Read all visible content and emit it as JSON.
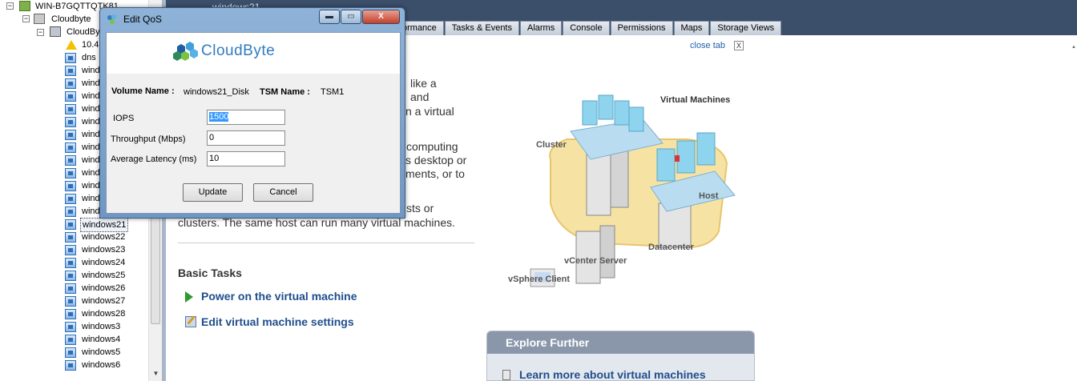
{
  "tree": {
    "root_label": "WIN-B7GQTTQTK81",
    "datacenter_label": "Cloudbyte",
    "cluster_label": "CloudBy",
    "host_label": "10.4",
    "items": [
      "dns",
      "windo",
      "windo",
      "windo",
      "windo",
      "windo",
      "windo",
      "windo",
      "windo",
      "windo",
      "windo",
      "windo",
      "windows20",
      "windows21",
      "windows22",
      "windows23",
      "windows24",
      "windows25",
      "windows26",
      "windows27",
      "windows28",
      "windows3",
      "windows4",
      "windows5",
      "windows6"
    ],
    "selected_item": "windows21",
    "expander_open": "−"
  },
  "header": {
    "vm_title": "windows21"
  },
  "tabs": [
    {
      "label": "ormance"
    },
    {
      "label": "Tasks & Events"
    },
    {
      "label": "Alarms"
    },
    {
      "label": "Console"
    },
    {
      "label": "Permissions"
    },
    {
      "label": "Maps"
    },
    {
      "label": "Storage Views"
    }
  ],
  "main": {
    "close_tab_label": "close tab",
    "close_tab_x": "X",
    "intro_fragments": [
      "like a",
      "and",
      "n a virtual",
      "computing",
      "s desktop or",
      "ments, or to",
      "sts or",
      "clusters. The same host can run many virtual machines."
    ],
    "basic_tasks_title": "Basic Tasks",
    "tasks": [
      {
        "label": "Power on the virtual machine",
        "icon": "play-icon"
      },
      {
        "label": "Edit virtual machine settings",
        "icon": "edit-settings-icon"
      }
    ],
    "explore": {
      "title": "Explore Further",
      "link": "Learn more about virtual machines"
    }
  },
  "diagram": {
    "labels": {
      "virtual_machines": "Virtual Machines",
      "cluster": "Cluster",
      "host": "Host",
      "datacenter": "Datacenter",
      "vcenter": "vCenter Server",
      "vsphere": "vSphere Client"
    },
    "colors": {
      "floor": "#f6e3a4",
      "floor_edge": "#e9c46a",
      "vm_tile": "#8ed4ee",
      "server": "#e4e4e4"
    }
  },
  "dialog": {
    "title": "Edit QoS",
    "logo_text": "CloudByte",
    "volume_name_label": "Volume Name :",
    "volume_name_value": "windows21_Disk",
    "tsm_name_label": "TSM Name :",
    "tsm_name_value": "TSM1",
    "iops_label": "IOPS",
    "iops_value": "1500",
    "throughput_label": "Throughput (Mbps)",
    "throughput_value": "0",
    "latency_label": "Average Latency (ms)",
    "latency_value": "10",
    "update_label": "Update",
    "cancel_label": "Cancel",
    "min_glyph": "▬",
    "max_glyph": "▭",
    "close_glyph": "X"
  },
  "colors": {
    "header_bg": "#3b4f6b",
    "link_blue": "#1f4e8c",
    "dialog_frame": "#7fa6cf",
    "brand_blue": "#2f7cbf"
  }
}
